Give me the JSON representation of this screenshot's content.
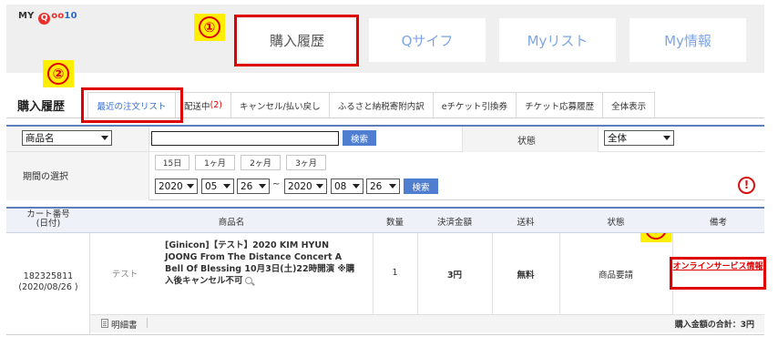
{
  "logo": {
    "my": "MY",
    "q": "Q",
    "oo": "oo",
    "ten": "10"
  },
  "nav": {
    "tabs": [
      {
        "label": "購入履歴"
      },
      {
        "label": "Qサイフ"
      },
      {
        "label": "Myリスト"
      },
      {
        "label": "My情報"
      }
    ]
  },
  "markers": [
    "①",
    "②",
    "③"
  ],
  "section_title": "購入履歴",
  "subtabs": [
    {
      "label": "最近の注文リスト"
    },
    {
      "label": "配送中",
      "count": "(2)"
    },
    {
      "label": "キャンセル/払い戻し"
    },
    {
      "label": "ふるさと納税寄附内訳"
    },
    {
      "label": "eチケット引換券"
    },
    {
      "label": "チケット応募履歴"
    },
    {
      "label": "全体表示"
    }
  ],
  "filter": {
    "field_select": "商品名",
    "search_value": "",
    "search_button": "検索",
    "status_label": "状態",
    "status_select": "全体",
    "period_label": "期間の選択",
    "period_buttons": [
      "15日",
      "1ヶ月",
      "2ヶ月",
      "3ヶ月"
    ],
    "from": {
      "year": "2020",
      "month": "05",
      "day": "26"
    },
    "tilde": "~",
    "to": {
      "year": "2020",
      "month": "08",
      "day": "26"
    },
    "search_button2": "検索",
    "alert_icon": "!"
  },
  "table": {
    "headers": {
      "cart": "カート番号",
      "cart_sub": "(日付)",
      "product": "商品名",
      "qty": "数量",
      "amount": "決済金額",
      "shipping": "送料",
      "status": "状態",
      "remarks": "備考"
    },
    "rows": [
      {
        "cart_no": "182325811",
        "date": "(2020/08/26 )",
        "seller": "テスト",
        "product": "[Ginicon]【テスト】2020 KIM HYUN JOONG From The Distance Concert A Bell Of Blessing 10月3日(土)22時開演 ※購入後キャンセル不可",
        "qty": "1",
        "amount": "3円",
        "shipping": "無料",
        "status": "商品要請",
        "remark_link": "オンラインサービス情報"
      }
    ],
    "footer": {
      "detail_label": "明細書",
      "total_label": "購入金額の合計：",
      "total_value": "3円"
    }
  }
}
